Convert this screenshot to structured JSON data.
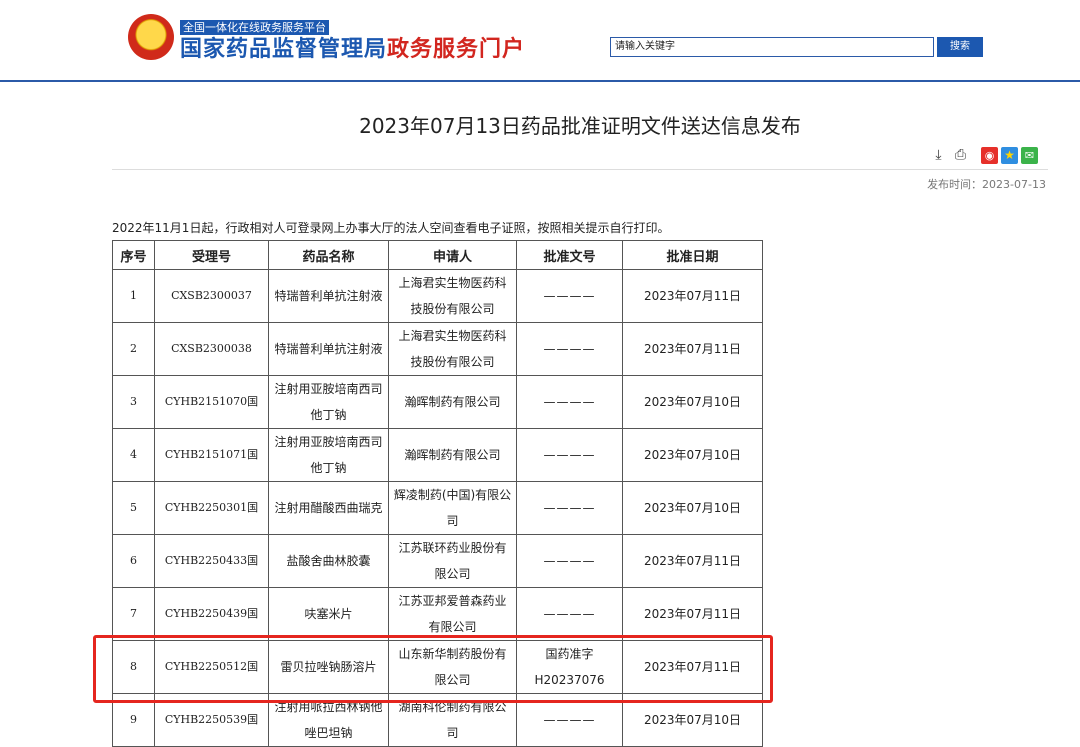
{
  "header": {
    "platform_tag": "全国一体化在线政务服务平台",
    "brand_blue": "国家药品监督管理局",
    "brand_red": "政务服务门户",
    "search_placeholder": "请输入关键字",
    "search_button": "搜索"
  },
  "article": {
    "title": "2023年07月13日药品批准证明文件送达信息发布",
    "tools": [
      "download-icon",
      "print-icon",
      "weibo-icon",
      "favorite-icon",
      "wechat-icon"
    ],
    "publish_label": "发布时间：2023-07-13",
    "notice": "2022年11月1日起，行政相对人可登录网上办事大厅的法人空间查看电子证照，按照相关提示自行打印。"
  },
  "table": {
    "headers": [
      "序号",
      "受理号",
      "药品名称",
      "申请人",
      "批准文号",
      "批准日期"
    ],
    "rows": [
      {
        "no": "1",
        "accept": "CXSB2300037",
        "drug": "特瑞普利单抗注射液",
        "applicant": "上海君实生物医药科技股份有限公司",
        "approval": "————",
        "date": "2023年07月11日"
      },
      {
        "no": "2",
        "accept": "CXSB2300038",
        "drug": "特瑞普利单抗注射液",
        "applicant": "上海君实生物医药科技股份有限公司",
        "approval": "————",
        "date": "2023年07月11日"
      },
      {
        "no": "3",
        "accept": "CYHB2151070国",
        "drug": "注射用亚胺培南西司他丁钠",
        "applicant": "瀚晖制药有限公司",
        "approval": "————",
        "date": "2023年07月10日"
      },
      {
        "no": "4",
        "accept": "CYHB2151071国",
        "drug": "注射用亚胺培南西司他丁钠",
        "applicant": "瀚晖制药有限公司",
        "approval": "————",
        "date": "2023年07月10日"
      },
      {
        "no": "5",
        "accept": "CYHB2250301国",
        "drug": "注射用醋酸西曲瑞克",
        "applicant": "辉凌制药(中国)有限公司",
        "approval": "————",
        "date": "2023年07月10日"
      },
      {
        "no": "6",
        "accept": "CYHB2250433国",
        "drug": "盐酸舍曲林胶囊",
        "applicant": "江苏联环药业股份有限公司",
        "approval": "————",
        "date": "2023年07月11日"
      },
      {
        "no": "7",
        "accept": "CYHB2250439国",
        "drug": "呋塞米片",
        "applicant": "江苏亚邦爱普森药业有限公司",
        "approval": "————",
        "date": "2023年07月11日"
      },
      {
        "no": "8",
        "accept": "CYHB2250512国",
        "drug": "雷贝拉唑钠肠溶片",
        "applicant": "山东新华制药股份有限公司",
        "approval": "国药准字H20237076",
        "date": "2023年07月11日"
      },
      {
        "no": "9",
        "accept": "CYHB2250539国",
        "drug": "注射用哌拉西林钠他唑巴坦钠",
        "applicant": "湖南科伦制药有限公司",
        "approval": "————",
        "date": "2023年07月10日"
      }
    ]
  },
  "colors": {
    "brand_blue": "#1c58b0",
    "brand_red": "#d2261f",
    "highlight": "#e5261f"
  }
}
